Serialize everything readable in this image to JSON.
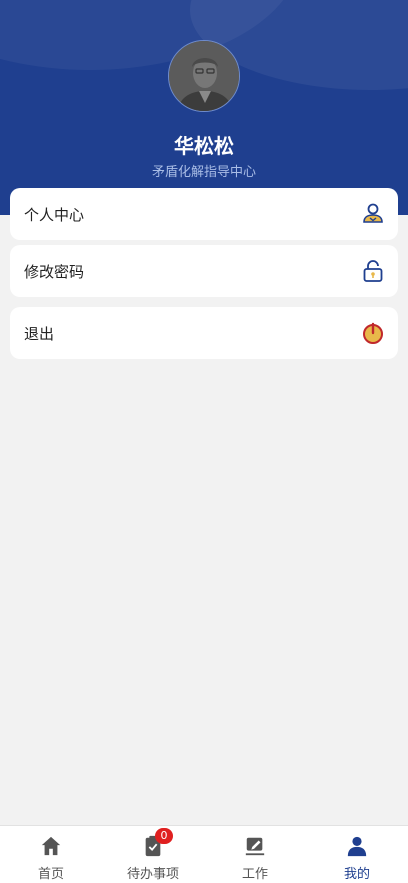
{
  "profile": {
    "name": "华松松",
    "organization": "矛盾化解指导中心"
  },
  "menu": {
    "personal_center": "个人中心",
    "change_password": "修改密码",
    "logout": "退出"
  },
  "tabbar": {
    "home": "首页",
    "todo": "待办事项",
    "todo_badge": "0",
    "work": "工作",
    "mine": "我的"
  },
  "colors": {
    "header": "#1f3f8f",
    "accent": "#1f3f8f",
    "badge": "#e02020",
    "gold": "#e8b84a"
  },
  "icons": {
    "personal_center": "user-card-icon",
    "change_password": "unlock-icon",
    "logout": "power-icon",
    "home": "home-icon",
    "todo": "clipboard-check-icon",
    "work": "edit-pad-icon",
    "mine": "person-icon"
  }
}
